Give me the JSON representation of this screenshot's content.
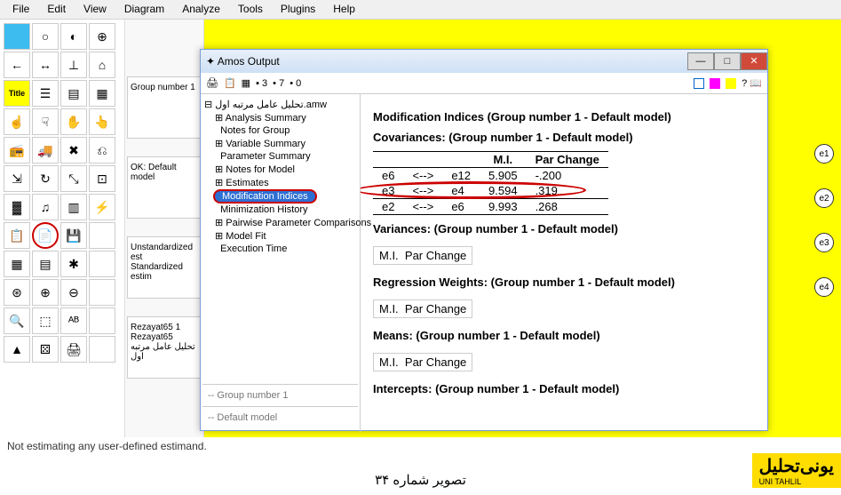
{
  "menu": {
    "items": [
      "File",
      "Edit",
      "View",
      "Diagram",
      "Analyze",
      "Tools",
      "Plugins",
      "Help"
    ]
  },
  "midpanel": {
    "group": "Group number 1",
    "ok": "OK: Default model",
    "unstd": "Unstandardized est",
    "std": "Standardized estim",
    "r1": "Rezayat65 1",
    "r2": "Rezayat65",
    "r3": "تحلیل عامل مرتبه اول"
  },
  "output": {
    "title": "Amos Output",
    "spin": {
      "a": "3",
      "b": "7",
      "c": "0"
    },
    "tree": {
      "root": "تحلیل عامل مرتبه اول.amw",
      "items": [
        "Analysis Summary",
        "Notes for Group",
        "Variable Summary",
        "Parameter Summary",
        "Notes for Model",
        "Estimates",
        "Modification Indices",
        "Minimization History",
        "Pairwise Parameter Comparisons",
        "Model Fit",
        "Execution Time"
      ],
      "g1": "-- Group number 1",
      "dm": "-- Default model"
    },
    "headings": {
      "modidx": "Modification Indices (Group number 1 - Default model)",
      "cov": "Covariances: (Group number 1 - Default model)",
      "var": "Variances: (Group number 1 - Default model)",
      "reg": "Regression Weights: (Group number 1 - Default model)",
      "means": "Means: (Group number 1 - Default model)",
      "intc": "Intercepts: (Group number 1 - Default model)"
    },
    "cov_cols": {
      "mi": "M.I.",
      "par": "Par Change"
    },
    "cov_rows": [
      {
        "a": "e6",
        "arr": "<-->",
        "b": "e12",
        "mi": "5.905",
        "par": "-.200"
      },
      {
        "a": "e3",
        "arr": "<-->",
        "b": "e4",
        "mi": "9.594",
        "par": ".319"
      },
      {
        "a": "e2",
        "arr": "<-->",
        "b": "e6",
        "mi": "9.993",
        "par": ".268"
      }
    ]
  },
  "enodes": [
    "e1",
    "e2",
    "e3",
    "e4"
  ],
  "status": "Not estimating any user-defined estimand.",
  "caption": "تصویر شماره ۳۴",
  "logo": {
    "big": "یونی‌تحلیل",
    "small": "UNI TAHLIL"
  }
}
